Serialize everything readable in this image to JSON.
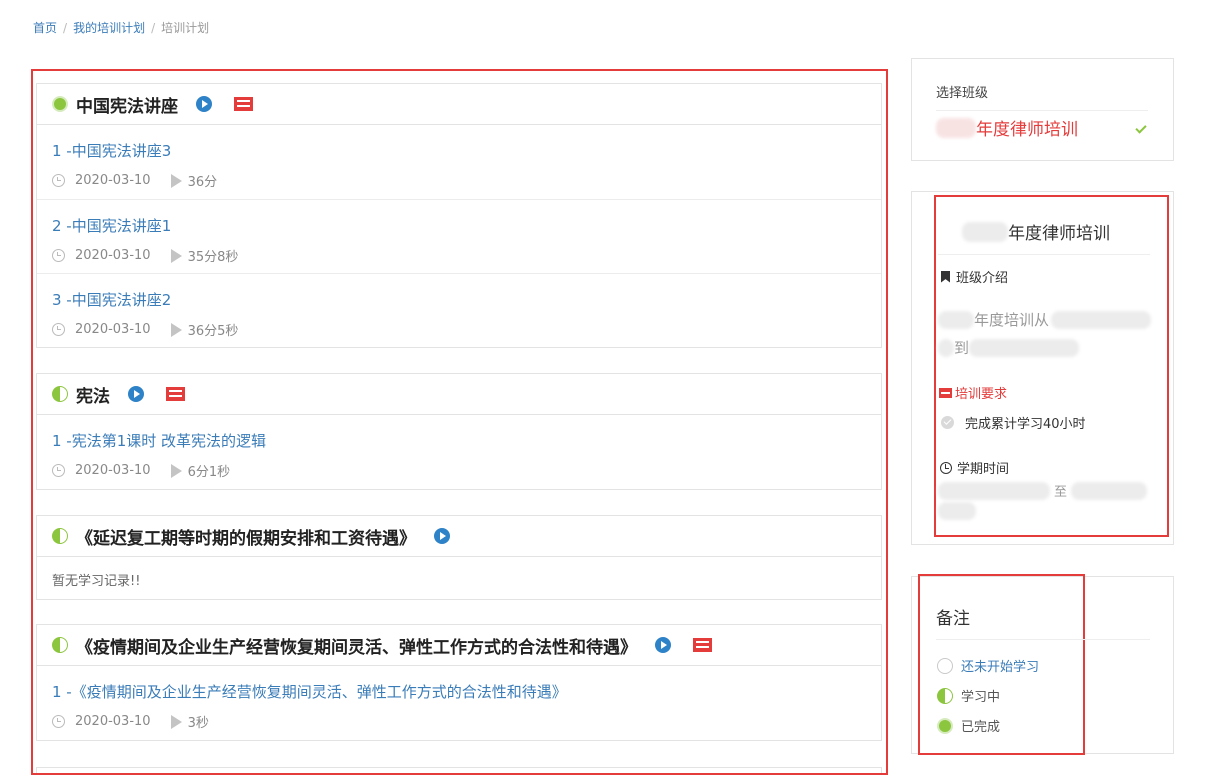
{
  "breadcrumb": {
    "home": "首页",
    "my_plans": "我的培训计划",
    "current": "培训计划",
    "sep": "/"
  },
  "courses": [
    {
      "title": "中国宪法讲座",
      "status": "done",
      "lessons": [
        {
          "title": "1 -中国宪法讲座3",
          "date": "2020-03-10",
          "duration": "36分"
        },
        {
          "title": "2 -中国宪法讲座1",
          "date": "2020-03-10",
          "duration": "35分8秒"
        },
        {
          "title": "3 -中国宪法讲座2",
          "date": "2020-03-10",
          "duration": "36分5秒"
        }
      ]
    },
    {
      "title": "宪法",
      "status": "in-progress",
      "lessons": [
        {
          "title": "1 -宪法第1课时 改革宪法的逻辑",
          "date": "2020-03-10",
          "duration": "6分1秒"
        }
      ]
    },
    {
      "title": "《延迟复工期等时期的假期安排和工资待遇》",
      "status": "in-progress",
      "empty_text": "暂无学习记录!!"
    },
    {
      "title": "《疫情期间及企业生产经营恢复期间灵活、弹性工作方式的合法性和待遇》",
      "status": "in-progress",
      "lessons": [
        {
          "title": "1 -《疫情期间及企业生产经营恢复期间灵活、弹性工作方式的合法性和待遇》",
          "date": "2020-03-10",
          "duration": "3秒"
        }
      ]
    }
  ],
  "class_select": {
    "label": "选择班级",
    "value": "年度律师培训"
  },
  "class_info": {
    "name": "年度律师培训",
    "intro_label": "班级介绍",
    "intro_text_1": "年度培训从",
    "intro_text_2": "到",
    "requirement_label": "培训要求",
    "requirement_item": "完成累计学习40小时",
    "term_label": "学期时间",
    "term_to": "至"
  },
  "legend": {
    "title": "备注",
    "items": [
      {
        "label": "还未开始学习",
        "color": "#3a7cb8"
      },
      {
        "label": "学习中",
        "color": "#555555"
      },
      {
        "label": "已完成",
        "color": "#555555"
      }
    ]
  },
  "colors": {
    "accent": "#e43b3b",
    "link": "#3a7cb8",
    "done": "#8cc63f"
  }
}
